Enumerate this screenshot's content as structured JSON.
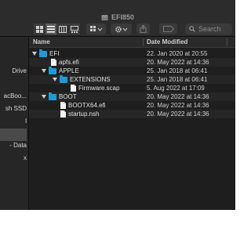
{
  "window": {
    "title": "EFI850"
  },
  "toolbar": {
    "search_placeholder": "Search"
  },
  "sidebar": {
    "items": [
      {
        "label": "Drive"
      },
      {
        "label": "acBoo..."
      },
      {
        "label": "sh SSD"
      },
      {
        "label": "l"
      },
      {
        "label": "- Data"
      },
      {
        "label": "x"
      }
    ]
  },
  "columns": {
    "name": "Name",
    "date_modified": "Date Modified"
  },
  "rows": [
    {
      "name": "EFI",
      "date": "22. Jan 2020 at 20:55"
    },
    {
      "name": "apfs.efi",
      "date": "20. May 2022 at 14:36"
    },
    {
      "name": "APPLE",
      "date": "25. Jan 2018 at 06:41"
    },
    {
      "name": "EXTENSIONS",
      "date": "25. Jan 2018 at 06:41"
    },
    {
      "name": "Firmware.scap",
      "date": "5. Aug 2022 at 17:09"
    },
    {
      "name": "BOOT",
      "date": "20. May 2022 at 14:36"
    },
    {
      "name": "BOOTX64.efi",
      "date": "20. May 2022 at 14:36"
    },
    {
      "name": "startup.nsh",
      "date": "20. May 2022 at 14:36"
    }
  ],
  "colors": {
    "folder": "#1b9cd8",
    "window_bg": "#1e1e1e",
    "toolbar_bg": "#2c2c2c"
  }
}
